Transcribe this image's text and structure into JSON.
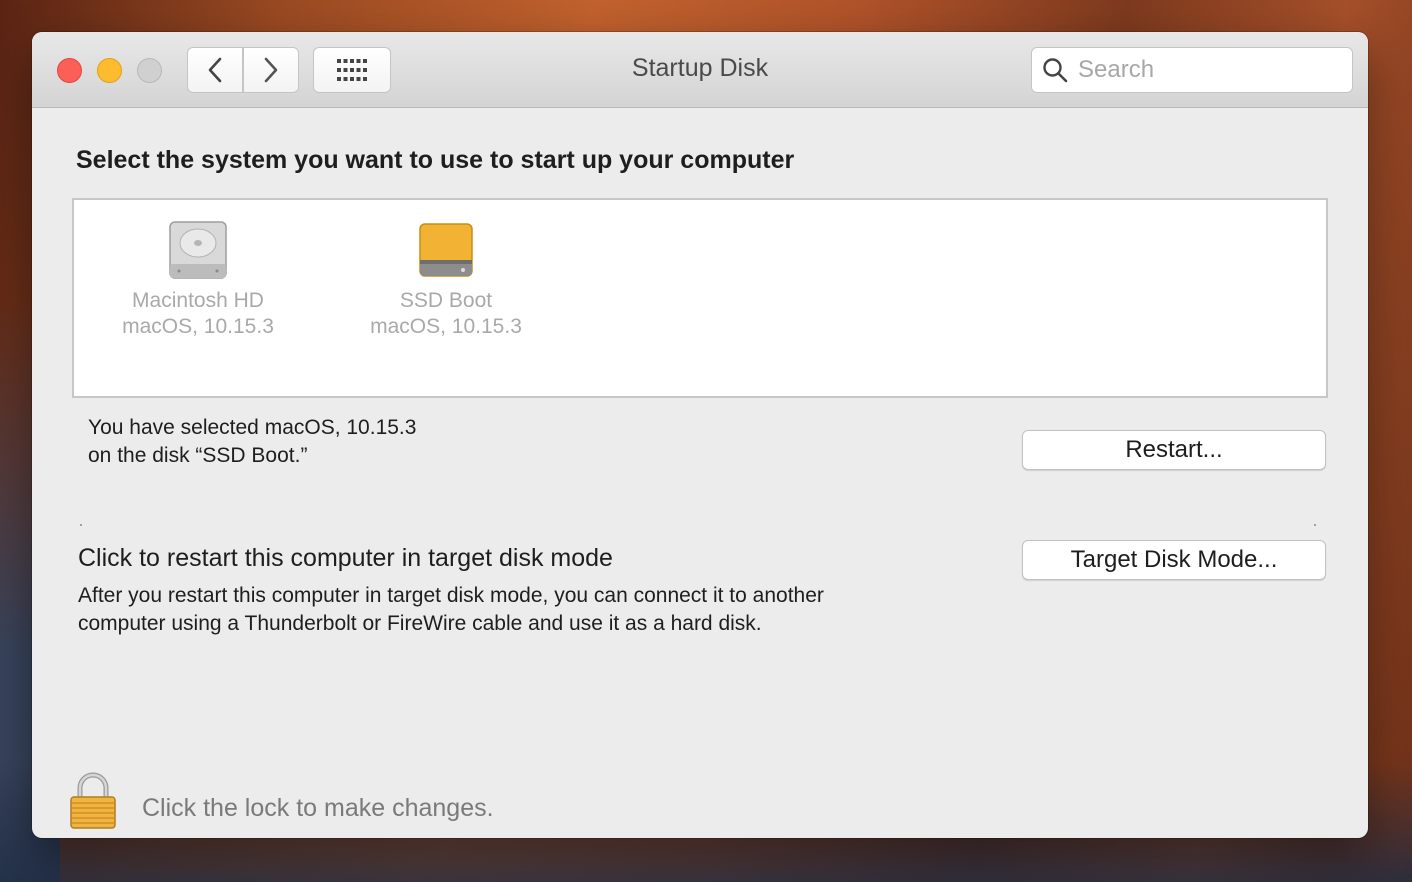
{
  "window": {
    "title": "Startup Disk"
  },
  "toolbar": {
    "back_icon": "chevron-left-icon",
    "forward_icon": "chevron-right-icon",
    "grid_icon": "grid-icon"
  },
  "search": {
    "placeholder": "Search",
    "value": ""
  },
  "main": {
    "heading": "Select the system you want to use to start up your computer",
    "disks": [
      {
        "name": "Macintosh HD",
        "os": "macOS, 10.15.3",
        "icon": "hard-disk-icon",
        "color": "#c8c8c8"
      },
      {
        "name": "SSD Boot",
        "os": "macOS, 10.15.3",
        "icon": "external-disk-icon",
        "color": "#f2b233"
      }
    ],
    "status_line1": "You have selected macOS, 10.15.3",
    "status_line2": "on the disk “SSD Boot.”",
    "restart_label": "Restart...",
    "target_title": "Click to restart this computer in target disk mode",
    "target_desc": "After you restart this computer in target disk mode, you can connect it to another computer using a Thunderbolt or FireWire cable and use it as a hard disk.",
    "target_button_label": "Target Disk Mode..."
  },
  "footer": {
    "lock_icon": "lock-icon",
    "lock_text": "Click the lock to make changes."
  },
  "colors": {
    "close": "#fc5f57",
    "minimize": "#fdbc2e",
    "zoom_disabled": "#d0d0d0",
    "lock_gold": "#f0b443"
  }
}
